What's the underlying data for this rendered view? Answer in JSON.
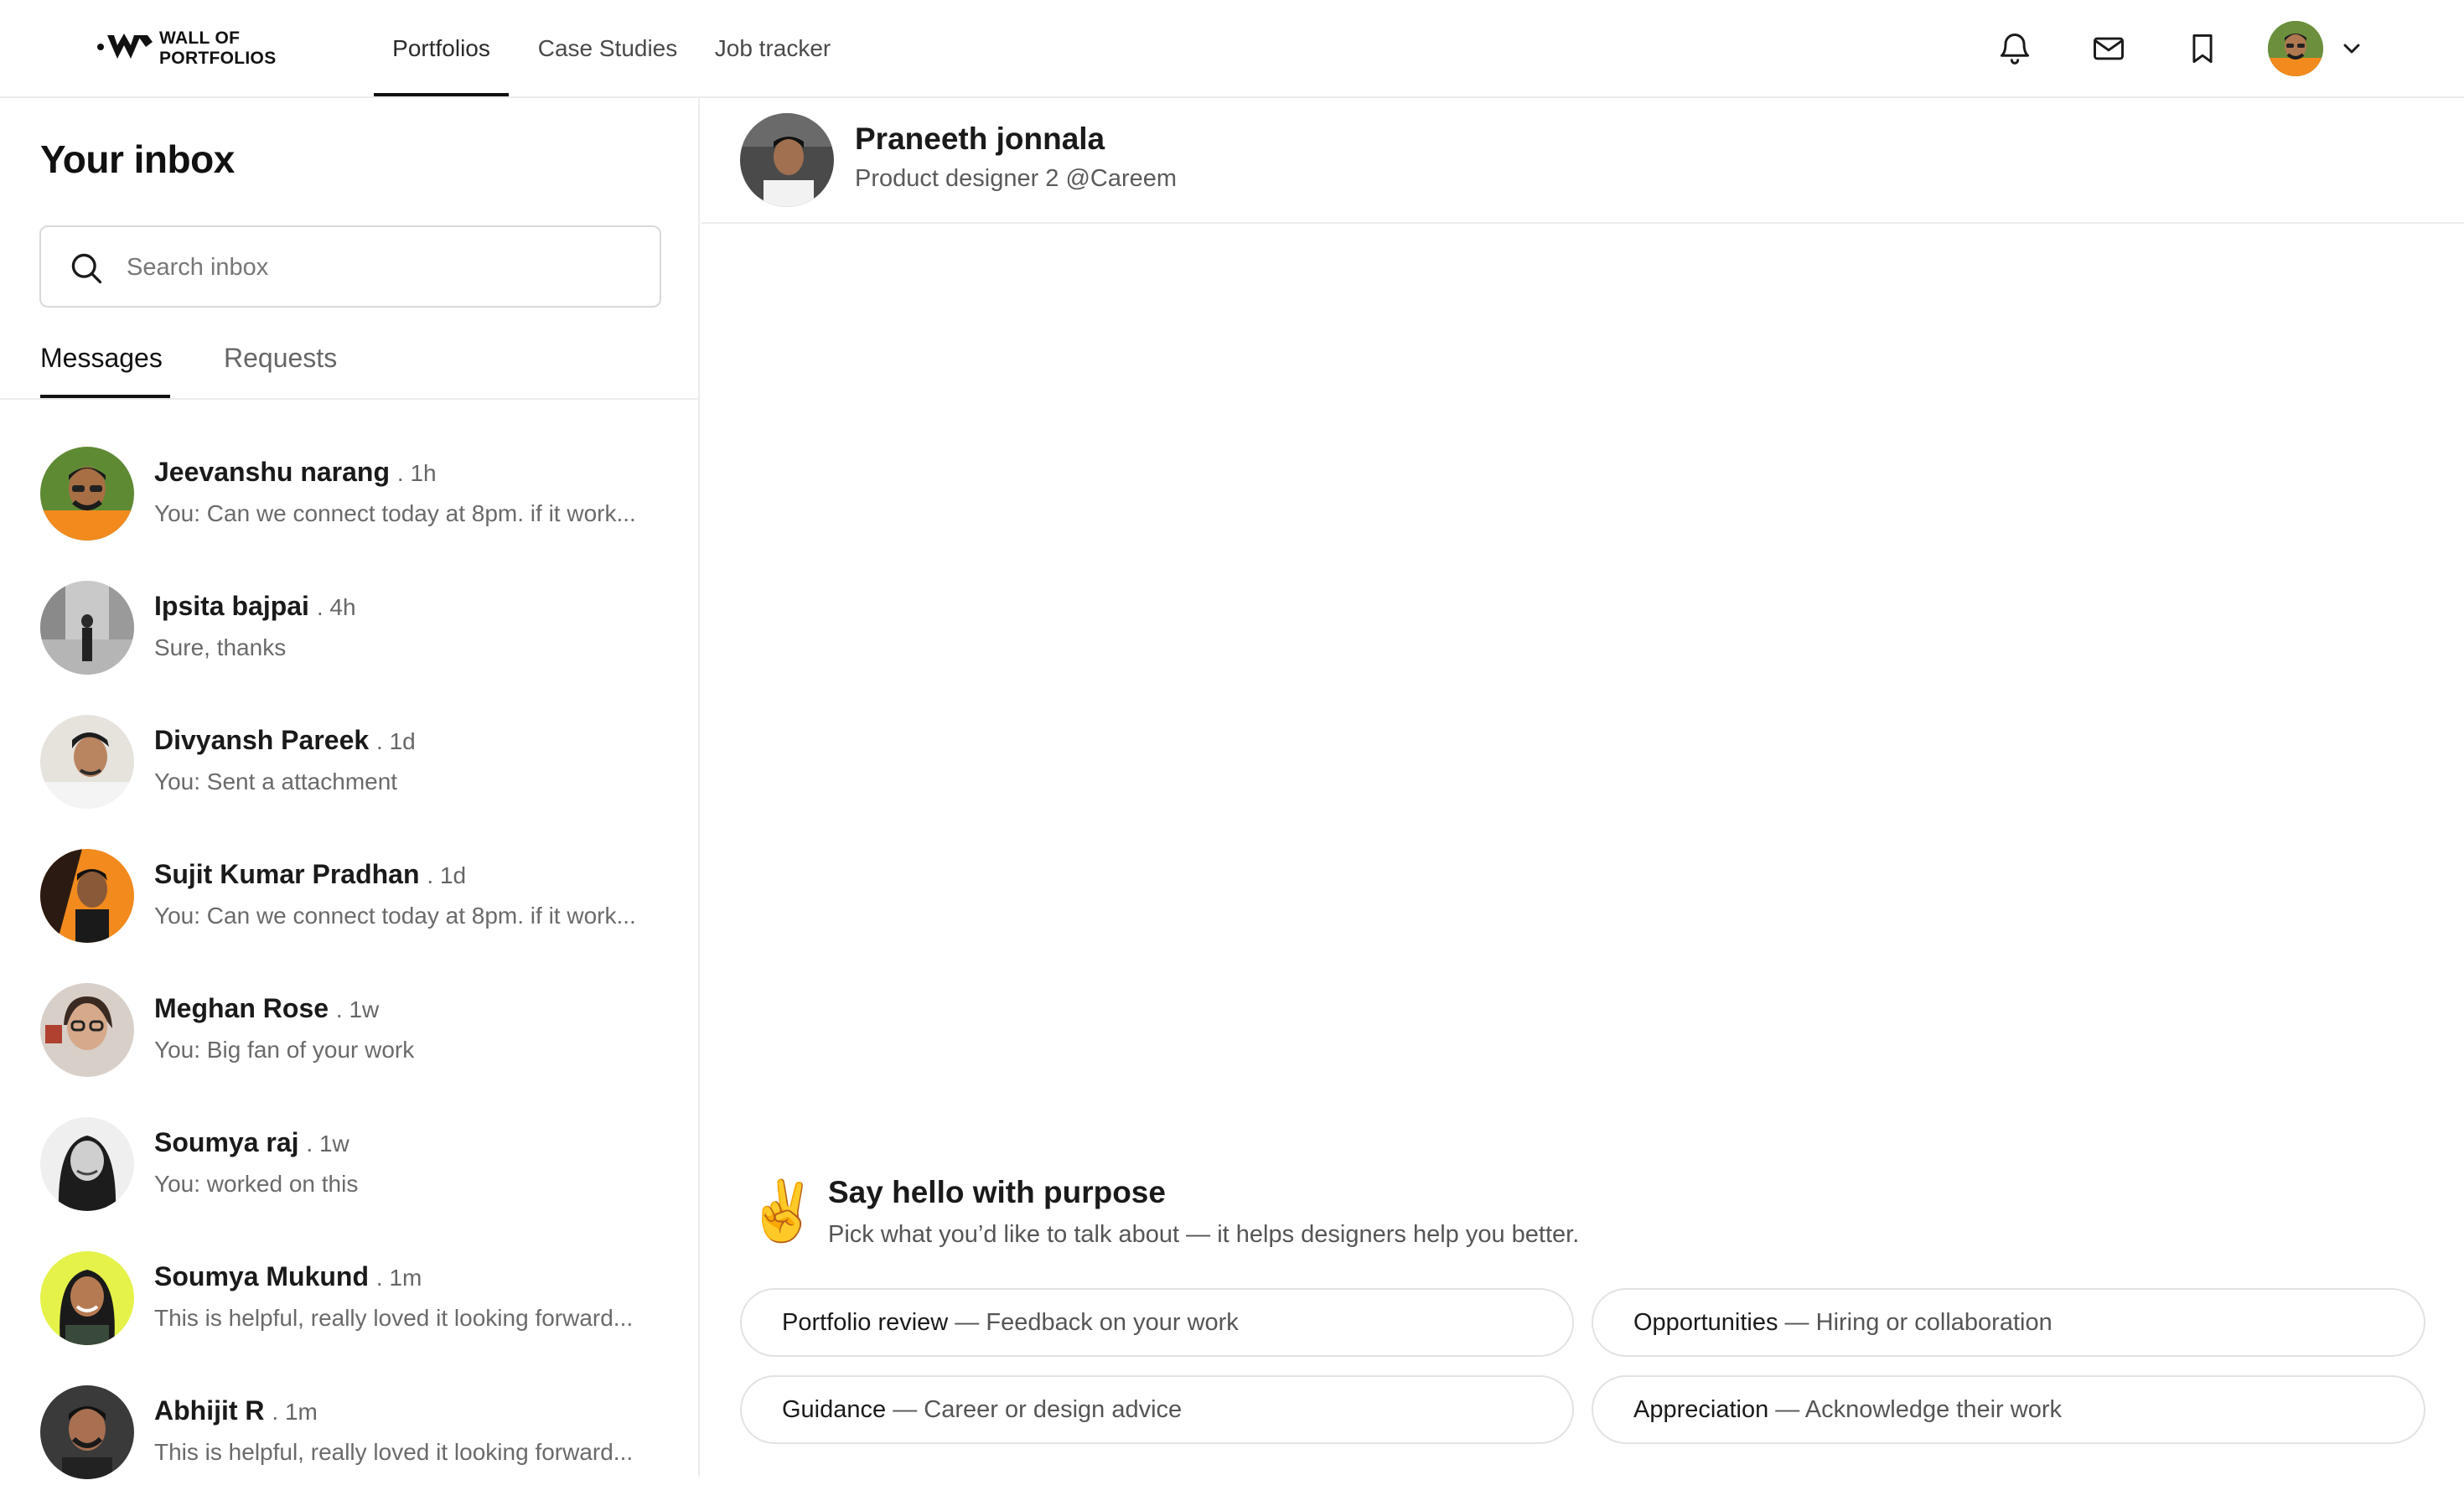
{
  "brand": {
    "line1": "WALL OF",
    "line2": "PORTFOLIOS"
  },
  "nav": {
    "tabs": [
      {
        "label": "Portfolios"
      },
      {
        "label": "Case Studies"
      },
      {
        "label": "Job tracker"
      }
    ],
    "active_tab": "Portfolios",
    "icons": [
      "bell-icon",
      "mail-icon",
      "bookmark-icon",
      "chevron-down-icon"
    ]
  },
  "inbox": {
    "title": "Your inbox",
    "search_placeholder": "Search inbox",
    "tabs": [
      {
        "label": "Messages"
      },
      {
        "label": "Requests"
      }
    ],
    "active_tab": "Messages",
    "messages": [
      {
        "name": "Jeevanshu narang",
        "time": ". 1h",
        "preview": "You: Can we connect today at 8pm. if it work..."
      },
      {
        "name": "Ipsita bajpai",
        "time": ". 4h",
        "preview": "Sure, thanks"
      },
      {
        "name": "Divyansh Pareek",
        "time": ". 1d",
        "preview": "You: Sent a attachment"
      },
      {
        "name": "Sujit Kumar Pradhan",
        "time": ". 1d",
        "preview": "You: Can we connect today at 8pm. if it work..."
      },
      {
        "name": "Meghan Rose",
        "time": ". 1w",
        "preview": "You: Big fan of your work"
      },
      {
        "name": "Soumya raj",
        "time": ". 1w",
        "preview": "You: worked on this"
      },
      {
        "name": "Soumya Mukund",
        "time": ". 1m",
        "preview": "This is helpful, really loved it looking forward..."
      },
      {
        "name": "Abhijit R",
        "time": ". 1m",
        "preview": "This is helpful, really loved it looking forward..."
      }
    ]
  },
  "chat": {
    "contact_name": "Praneeth jonnala",
    "contact_role": "Product  designer 2 @Careem",
    "hello_title": "Say hello with purpose",
    "hello_subtitle": "Pick what you’d like to talk about — it helps designers help you better.",
    "hello_emoji": "✌️",
    "chips": [
      {
        "label": "Portfolio review",
        "sep": " — ",
        "desc": "Feedback on your work"
      },
      {
        "label": "Opportunities",
        "sep": " — ",
        "desc": "Hiring or collaboration"
      },
      {
        "label": "Guidance",
        "sep": " — ",
        "desc": "Career or design advice"
      },
      {
        "label": "Appreciation",
        "sep": " — ",
        "desc": "Acknowledge their work"
      }
    ]
  },
  "colors": {
    "text": "#1c1c1c",
    "muted": "#6a6a6a",
    "border": "#ececec",
    "accent": "#111111"
  }
}
